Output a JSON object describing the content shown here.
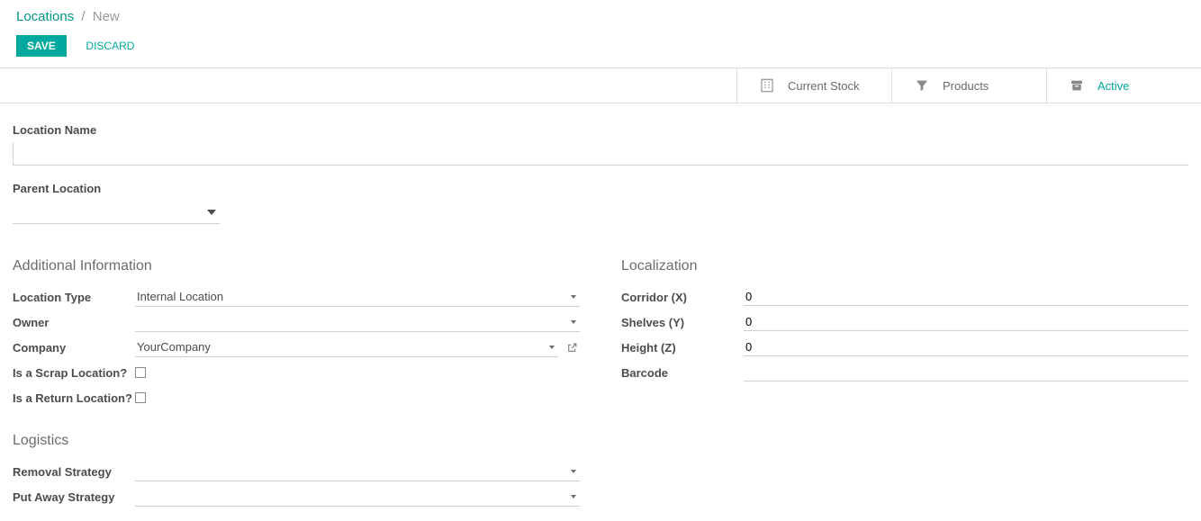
{
  "breadcrumb": {
    "root": "Locations",
    "sep": "/",
    "current": "New"
  },
  "buttons": {
    "save": "SAVE",
    "discard": "DISCARD"
  },
  "statbar": {
    "current_stock": "Current Stock",
    "products": "Products",
    "active": "Active"
  },
  "fields": {
    "location_name_label": "Location Name",
    "location_name_value": "",
    "parent_location_label": "Parent Location",
    "parent_location_value": ""
  },
  "sections": {
    "additional_info": "Additional Information",
    "localization": "Localization",
    "logistics": "Logistics"
  },
  "additional_info": {
    "location_type_label": "Location Type",
    "location_type_value": "Internal Location",
    "owner_label": "Owner",
    "owner_value": "",
    "company_label": "Company",
    "company_value": "YourCompany",
    "scrap_label": "Is a Scrap Location?",
    "return_label": "Is a Return Location?"
  },
  "localization": {
    "corridor_label": "Corridor (X)",
    "corridor_value": "0",
    "shelves_label": "Shelves (Y)",
    "shelves_value": "0",
    "height_label": "Height (Z)",
    "height_value": "0",
    "barcode_label": "Barcode",
    "barcode_value": ""
  },
  "logistics": {
    "removal_label": "Removal Strategy",
    "removal_value": "",
    "putaway_label": "Put Away Strategy",
    "putaway_value": ""
  }
}
